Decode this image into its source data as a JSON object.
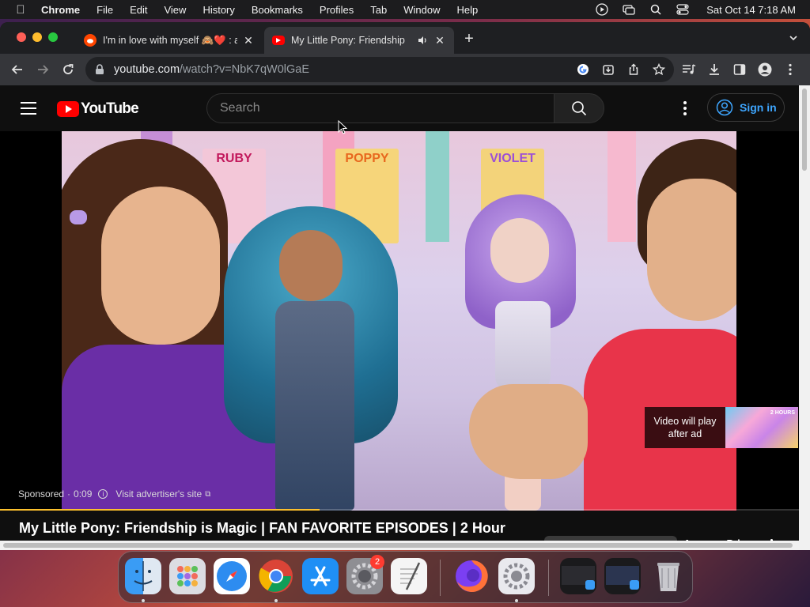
{
  "menubar": {
    "app": "Chrome",
    "items": [
      "File",
      "Edit",
      "View",
      "History",
      "Bookmarks",
      "Profiles",
      "Tab",
      "Window",
      "Help"
    ],
    "clock": "Sat Oct 14  7:18 AM"
  },
  "tabs": [
    {
      "title": "I'm in love with myself 🙈❤️ : a",
      "favicon": "reddit-icon",
      "active": false
    },
    {
      "title": "My Little Pony: Friendship",
      "favicon": "youtube-icon",
      "active": true
    }
  ],
  "omnibox": {
    "url_host": "youtube.com",
    "url_path": "/watch?v=NbK7qW0lGaE"
  },
  "youtube": {
    "logo_text": "YouTube",
    "search_placeholder": "Search",
    "signin_label": "Sign in",
    "video_posters": [
      "RUBY",
      "POPPY",
      "VIOLET"
    ],
    "sponsored_label": "Sponsored",
    "ad_time": "0:09",
    "visit_label": "Visit advertiser's site",
    "ad_notice": "Video will play after ad",
    "ad_progress": 0.4,
    "video_title": "My Little Pony: Friendship is Magic | FAN FAVORITE EPISODES | 2 Hour",
    "side_title": "Average Price"
  },
  "dock": {
    "apps": [
      "Finder",
      "Launchpad",
      "Safari",
      "Google Chrome",
      "App Store",
      "System Preferences",
      "TextEdit",
      "Firefox",
      "System Settings",
      "Window 1",
      "Window 2",
      "Trash"
    ],
    "settings_badge": "2"
  },
  "colors": {
    "youtube_red": "#ff0000",
    "link_blue": "#3ea6ff",
    "ad_progress": "#fbc02d"
  }
}
